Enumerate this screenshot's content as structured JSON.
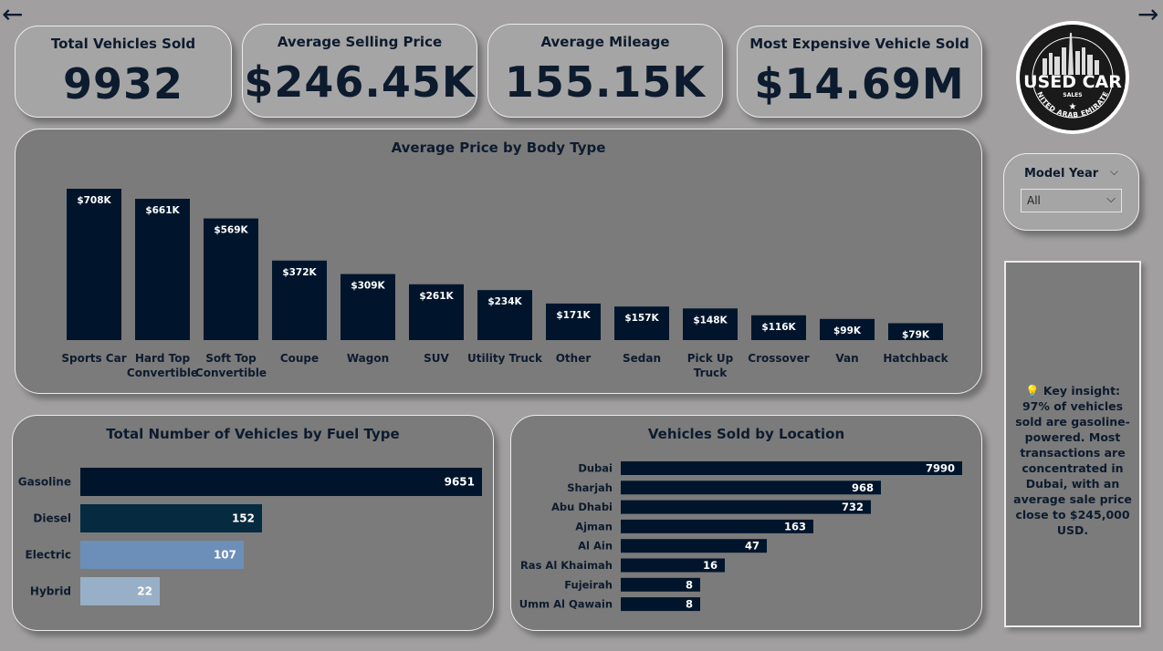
{
  "nav": {
    "back_icon": "←",
    "forward_icon": "→"
  },
  "kpis": [
    {
      "label": "Total Vehicles Sold",
      "value": "9932"
    },
    {
      "label": "Average Selling Price",
      "value": "$246.45K"
    },
    {
      "label": "Average Mileage",
      "value": "155.15K"
    },
    {
      "label": "Most Expensive Vehicle Sold",
      "value": "$14.69M"
    }
  ],
  "logo": {
    "line1": "USED CAR",
    "line2": "SALES",
    "line3": "UNITED ARAB EMIRATES"
  },
  "slicer": {
    "title": "Model Year",
    "value": "All",
    "chevron": "⌵"
  },
  "insight": {
    "icon": "💡",
    "text": "Key insight: 97% of vehicles sold are gasoline-powered. Most transactions are concentrated in Dubai, with an average sale price close to $245,000 USD."
  },
  "colors": {
    "navy": "#00152c",
    "dark_teal": "#062b40",
    "steel_blue": "#6b8fb8",
    "light_blue": "#98b0c7",
    "panel": "#7b7b7b",
    "card": "#a6a5a5",
    "background": "#a19f9f"
  },
  "chart_data": [
    {
      "type": "bar",
      "title": "Average Price by Body Type",
      "categories": [
        "Sports Car",
        "Hard Top Convertible",
        "Soft Top Convertible",
        "Coupe",
        "Wagon",
        "SUV",
        "Utility Truck",
        "Other",
        "Sedan",
        "Pick Up Truck",
        "Crossover",
        "Van",
        "Hatchback"
      ],
      "category_lines": [
        [
          "Sports Car"
        ],
        [
          "Hard Top",
          "Convertible"
        ],
        [
          "Soft Top",
          "Convertible"
        ],
        [
          "Coupe"
        ],
        [
          "Wagon"
        ],
        [
          "SUV"
        ],
        [
          "Utility Truck"
        ],
        [
          "Other"
        ],
        [
          "Sedan"
        ],
        [
          "Pick Up",
          "Truck"
        ],
        [
          "Crossover"
        ],
        [
          "Van"
        ],
        [
          "Hatchback"
        ]
      ],
      "values": [
        708,
        661,
        569,
        372,
        309,
        261,
        234,
        171,
        157,
        148,
        116,
        99,
        79
      ],
      "data_labels": [
        "$708K",
        "$661K",
        "$569K",
        "$372K",
        "$309K",
        "$261K",
        "$234K",
        "$171K",
        "$157K",
        "$148K",
        "$116K",
        "$99K",
        "$79K"
      ],
      "unit": "K USD",
      "ylim": [
        0,
        708
      ]
    },
    {
      "type": "bar",
      "orientation": "horizontal",
      "title": "Total Number of Vehicles by Fuel Type",
      "categories": [
        "Gasoline",
        "Diesel",
        "Electric",
        "Hybrid"
      ],
      "values": [
        9651,
        152,
        107,
        22
      ],
      "bar_colors": [
        "#00152c",
        "#062b40",
        "#6b8fb8",
        "#98b0c7"
      ]
    },
    {
      "type": "bar",
      "orientation": "horizontal",
      "title": "Vehicles Sold by Location",
      "categories": [
        "Dubai",
        "Sharjah",
        "Abu Dhabi",
        "Ajman",
        "Al Ain",
        "Ras Al Khaimah",
        "Fujeirah",
        "Umm Al Qawain"
      ],
      "values": [
        7990,
        968,
        732,
        163,
        47,
        16,
        8,
        8
      ]
    }
  ]
}
